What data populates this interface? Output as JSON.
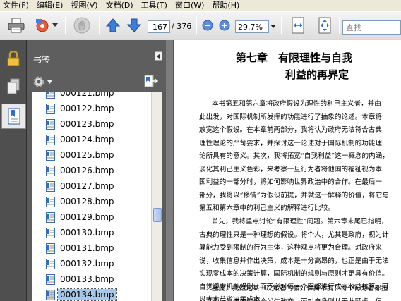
{
  "menu": [
    {
      "label": "文件(F)"
    },
    {
      "label": "编辑(E)"
    },
    {
      "label": "视图(V)"
    },
    {
      "label": "文档(D)"
    },
    {
      "label": "工具(T)"
    },
    {
      "label": "窗口(W)"
    },
    {
      "label": "帮助(H)"
    }
  ],
  "toolbar": {
    "print_icon": "printer-icon",
    "multimedia_icon": "multimedia-icon",
    "hand_icon": "hand-icon",
    "prev_icon": "arrow-up-icon",
    "next_icon": "arrow-down-icon",
    "current_page": "167",
    "page_total": "/ 376",
    "zoom_value": "29.7%",
    "search_placeholder": "查找",
    "accent": "#2a6fd6"
  },
  "sidebar": {
    "title": "书签",
    "items": [
      {
        "label": "000121.bmp"
      },
      {
        "label": "000122.bmp"
      },
      {
        "label": "000123.bmp"
      },
      {
        "label": "000124.bmp"
      },
      {
        "label": "000125.bmp"
      },
      {
        "label": "000126.bmp"
      },
      {
        "label": "000127.bmp"
      },
      {
        "label": "000128.bmp"
      },
      {
        "label": "000129.bmp"
      },
      {
        "label": "000130.bmp"
      },
      {
        "label": "000131.bmp"
      },
      {
        "label": "000132.bmp"
      },
      {
        "label": "000133.bmp"
      },
      {
        "label": "000134.bmp",
        "selected": true
      }
    ]
  },
  "document": {
    "chapter_title": "第七章　有限理性与自我",
    "chapter_subtitle": "利益的再界定",
    "para1": [
      "本书第五和第六章将政府假设为理性的利己主义者，并由",
      "此出发，对国际机制所发挥的功能进行了抽象的论述。本章将",
      "放宽这个假设。在本章前两部分，我将认为政府无法符合古典",
      "理性理论的严苛要求，并探讨这一论述对于国际机制的功能理",
      "论所具有的意义。其次，我将拓宽“自我利益”这一概念的内涵，",
      "淡化其利己主义色彩，来考察一旦行为者将他国的福祉视为本",
      "国利益的一部分时，将如何影响世界政治中的合作。在最后一",
      "部分，我将以“移情”为假设前提，并就这一解释的价值，将它与",
      "第五和第六章中的利己主义的解释进行比较。"
    ],
    "para2": [
      "首先，我将重点讨论“有限理性”问题。第六章末尾已指明，",
      "古典的理性只是一种理想的假设。将个人，尤其是政府，视为计",
      "算能力受到限制的行为主体，这种观点将更为合理。对政府来",
      "说，收集信息并作出决策，成本是十分高昂的，也正是由于无法",
      "实现零成本的决策计算，国际机制的规则与原则才更具有价值。",
      "自觉遵守机制规则，而不必对每一个案都进行成本收益核算，可",
      "以大大节省决策成本。"
    ],
    "para3": [
      "至此，我假定某一决策者的偏好保持不变；每个行为者都担",
      "心其他行为者的偏好会发生改变，而对自身则从无此顾虑，但"
    ]
  }
}
